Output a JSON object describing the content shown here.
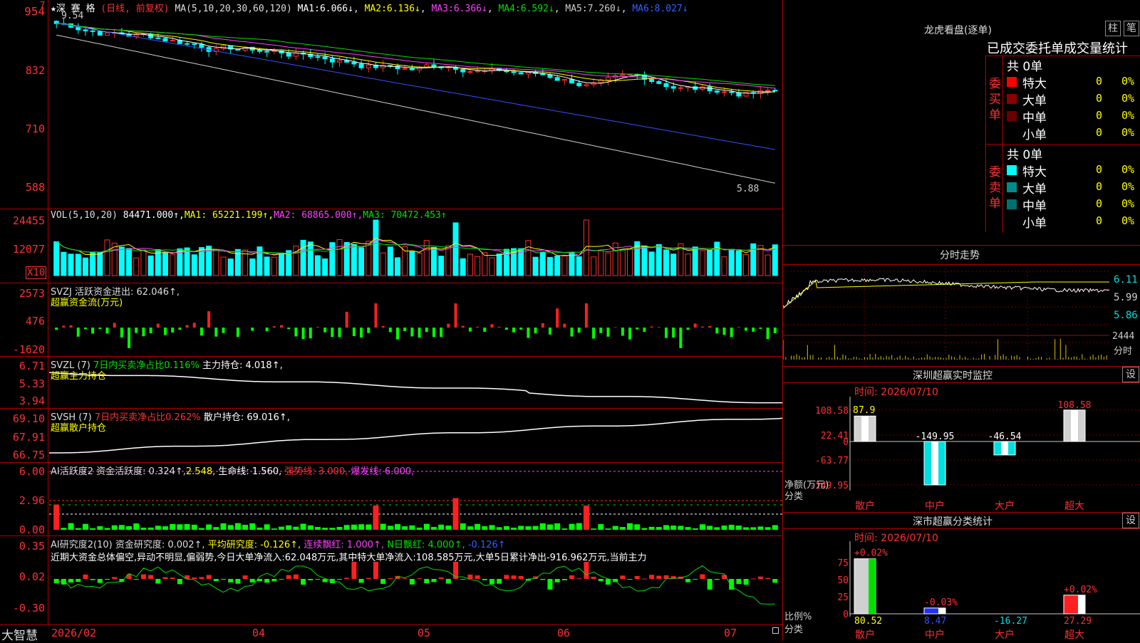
{
  "stock": {
    "star": "★",
    "name": "深 赛 格",
    "period": "(日线, 前复权)"
  },
  "ma_header": {
    "prefix": "MA(5,10,20,30,60,120)",
    "ma1_label": "MA1:",
    "ma1": "6.066↓",
    "ma2_label": "MA2:",
    "ma2": "6.136↓",
    "ma3_label": "MA3:",
    "ma3": "6.366↓",
    "ma4_label": "MA4:",
    "ma4": "6.592↓",
    "ma5_label": "MA5:",
    "ma5": "7.260↓",
    "ma6_label": "MA6:",
    "ma6": "8.027↓"
  },
  "price_axis": {
    "labels": [
      "954",
      "832",
      "710",
      "588"
    ],
    "high_mark": "9.54",
    "low_mark": "5.88",
    "marker": "7"
  },
  "vol": {
    "title": "VOL(5,10,20)",
    "value": "84471.000↑,",
    "ma1": "MA1: 65221.199↑,",
    "ma2": "MA2: 68865.000↑,",
    "ma3": "MA3: 70472.453↑",
    "axis": [
      "24455",
      "12077"
    ],
    "unit": "X10"
  },
  "svzj": {
    "title": "SVZJ  活跃资金进出: 62.046↑,",
    "subtitle": "超赢资金流(万元)",
    "axis": [
      "2573",
      "476",
      "-1620"
    ]
  },
  "svzl": {
    "title": "SVZL (7)",
    "ratio": "7日内买卖净占比0.116%",
    "hold": "主力持仓: 4.018↑,",
    "subtitle": "超赢主力持仓",
    "axis": [
      "6.71",
      "5.33",
      "3.94"
    ]
  },
  "svsh": {
    "title": "SVSH (7)",
    "ratio": "7日内买卖净占比0.262%",
    "hold": "散户持仓: 69.016↑,",
    "subtitle": "超赢散户持仓",
    "axis": [
      "69.10",
      "67.91",
      "66.75"
    ]
  },
  "ai1": {
    "title": "AI活跃度2 资金活跃度: 0.324↑,",
    "v2": "2.548,",
    "life": "生命线: 1.560,",
    "strong": "强势线: 3.000,",
    "burst": "爆发线: 6.000,",
    "axis": [
      "6.00",
      "2.96",
      "0.00"
    ]
  },
  "ai2": {
    "title": "AI研究度2(10) 资金研究度: 0.002↑,",
    "avg": "平均研究度: -0.126↑,",
    "cont": "连续飘红: 1.000↑,",
    "n": "N日飘红: 4.000↑,",
    "last": "-0.126↑",
    "comment": "近期大资金总体偏空,异动不明显,偏弱势,今日大单净流入:62.048万元,其中特大单净流入:108.585万元,大单5日累计净出-916.962万元,当前主力",
    "axis": [
      "0.35",
      "0.02",
      "-0.30"
    ]
  },
  "xaxis": {
    "brand": "大智慧",
    "labels": [
      "2026/02",
      "04",
      "05",
      "06",
      "07"
    ]
  },
  "dragon": {
    "title": "龙虎看盘(逐单)",
    "btn1": "柱",
    "btn2": "笔",
    "subtitle": "已成交委托单成交量统计",
    "buy_label": "委买单",
    "buy_total": "共 0单",
    "buy_rows": [
      {
        "name": "特大",
        "count": "0",
        "pct": "0%",
        "color": "#ff0000"
      },
      {
        "name": "大单",
        "count": "0",
        "pct": "0%",
        "color": "#8b0000"
      },
      {
        "name": "中单",
        "count": "0",
        "pct": "0%",
        "color": "#6b0000"
      },
      {
        "name": "小单",
        "count": "0",
        "pct": "0%",
        "color": "#000000"
      }
    ],
    "sell_label": "委卖单",
    "sell_total": "共 0单",
    "sell_rows": [
      {
        "name": "特大",
        "count": "0",
        "pct": "0%",
        "color": "#00ffff"
      },
      {
        "name": "大单",
        "count": "0",
        "pct": "0%",
        "color": "#008b8b"
      },
      {
        "name": "中单",
        "count": "0",
        "pct": "0%",
        "color": "#007070"
      },
      {
        "name": "小单",
        "count": "0",
        "pct": "0%",
        "color": "#000000"
      }
    ]
  },
  "intraday": {
    "title": "分时走势",
    "axis": [
      "6.11",
      "5.99",
      "5.86"
    ],
    "vol_top": "2444",
    "vol_label": "分时"
  },
  "monitor": {
    "title": "深圳超赢实时监控",
    "btn": "设",
    "time": "时间: 2026/07/10",
    "axis": [
      "108.58",
      "22.41",
      "0",
      "-63.77",
      "-149.95"
    ],
    "top_left": "87.9",
    "values": [
      {
        "cat": "散户",
        "label": "",
        "val": 87.9
      },
      {
        "cat": "中户",
        "label": "-149.95",
        "val": -149.95
      },
      {
        "cat": "大户",
        "label": "-46.54",
        "val": -46.54
      },
      {
        "cat": "超大",
        "label": "108.58",
        "val": 108.58
      }
    ],
    "unit": "净额(万元)",
    "cat_label": "分类"
  },
  "stats": {
    "title": "深市超赢分类统计",
    "btn": "设",
    "time": "时间: 2026/07/10",
    "axis": [
      "75",
      "50",
      "25",
      "0"
    ],
    "bars": [
      {
        "cat": "散户",
        "top": "+0.02%",
        "bottom": "80.52",
        "val": 80.52
      },
      {
        "cat": "中户",
        "top": "-0.03%",
        "bottom": "8.47",
        "val": 8.47
      },
      {
        "cat": "大户",
        "top": "",
        "bottom": "-16.27",
        "val": -16.27
      },
      {
        "cat": "超大",
        "top": "+0.02%",
        "bottom": "27.29",
        "val": 27.29
      }
    ],
    "ratio_label": "比例%",
    "cat_label": "分类"
  }
}
